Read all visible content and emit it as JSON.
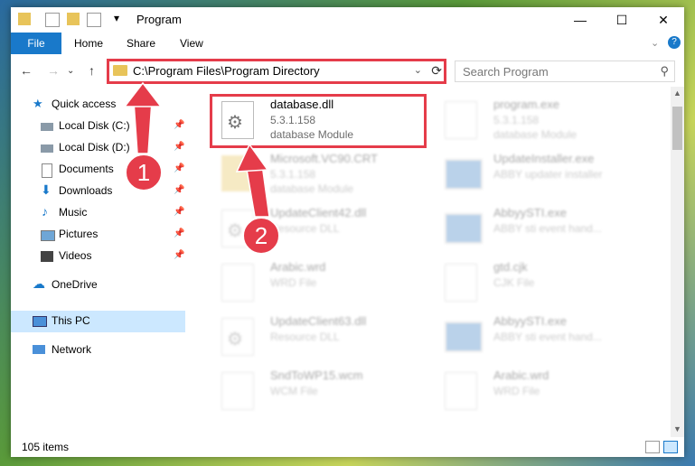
{
  "window": {
    "title": "Program"
  },
  "ribbon": {
    "tabs": [
      "File",
      "Home",
      "Share",
      "View"
    ]
  },
  "address": {
    "path": "C:\\Program Files\\Program Directory"
  },
  "search": {
    "placeholder": "Search Program"
  },
  "sidebar": {
    "items": [
      {
        "label": "Quick access",
        "icon": "star-icon"
      },
      {
        "label": "Local Disk (C:)",
        "icon": "drive-icon",
        "pinned": true
      },
      {
        "label": "Local Disk (D:)",
        "icon": "drive-icon",
        "pinned": true
      },
      {
        "label": "Documents",
        "icon": "documents-icon",
        "pinned": true
      },
      {
        "label": "Downloads",
        "icon": "download-icon",
        "pinned": true
      },
      {
        "label": "Music",
        "icon": "music-icon",
        "pinned": true
      },
      {
        "label": "Pictures",
        "icon": "pictures-icon",
        "pinned": true
      },
      {
        "label": "Videos",
        "icon": "videos-icon",
        "pinned": true
      },
      {
        "label": "OneDrive",
        "icon": "cloud-icon"
      },
      {
        "label": "This PC",
        "icon": "computer-icon",
        "selected": true
      },
      {
        "label": "Network",
        "icon": "network-icon"
      }
    ]
  },
  "files": [
    {
      "name": "database.dll",
      "version": "5.3.1.158",
      "desc": "database Module"
    },
    {
      "name": "program.exe",
      "version": "5.3.1.158",
      "desc": "database Module"
    },
    {
      "name": "Microsoft.VC90.CRT",
      "version": "5.3.1.158",
      "desc": "database Module"
    },
    {
      "name": "UpdateInstaller.exe",
      "version": "",
      "desc": "ABBY updater installer"
    },
    {
      "name": "UpdateClient42.dll",
      "version": "",
      "desc": "Resource DLL"
    },
    {
      "name": "AbbyySTI.exe",
      "version": "",
      "desc": "ABBY sti event hand..."
    },
    {
      "name": "Arabic.wrd",
      "version": "",
      "desc": "WRD File"
    },
    {
      "name": "gtd.cjk",
      "version": "",
      "desc": "CJK File"
    },
    {
      "name": "UpdateClient63.dll",
      "version": "",
      "desc": "Resource DLL"
    },
    {
      "name": "AbbyySTI.exe",
      "version": "",
      "desc": "ABBY sti event hand..."
    },
    {
      "name": "SndToWP15.wcm",
      "version": "",
      "desc": "WCM File"
    },
    {
      "name": "Arabic.wrd",
      "version": "",
      "desc": "WRD File"
    }
  ],
  "status": {
    "count": "105 items"
  },
  "callouts": [
    "1",
    "2"
  ],
  "colors": {
    "accent": "#1979ca",
    "highlight": "#e53c4a",
    "selected": "#cce8ff"
  }
}
